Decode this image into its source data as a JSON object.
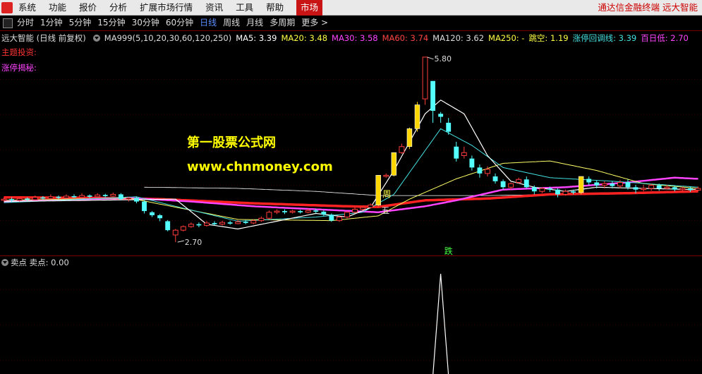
{
  "menubar": {
    "items": [
      "系统",
      "功能",
      "报价",
      "分析",
      "扩展市场行情",
      "资讯",
      "工具",
      "帮助"
    ],
    "market_tab": "市场",
    "brand": "通达信金融终端  远大智能"
  },
  "periodbar": {
    "items": [
      "分时",
      "1分钟",
      "5分钟",
      "15分钟",
      "30分钟",
      "60分钟",
      "日线",
      "周线",
      "月线",
      "多周期",
      "更多 >"
    ],
    "active": "日线"
  },
  "info": {
    "stock": "远大智能 (日线 前复权)",
    "indicator": "MA999(5,10,20,30,60,120,250)",
    "ma5": "MA5: 3.39",
    "ma20": "MA20: 3.48",
    "ma30": "MA30: 3.58",
    "ma60": "MA60: 3.74",
    "ma120": "MA120: 3.62",
    "ma250": "MA250: -",
    "gap": "跳空: 1.19",
    "limit": "涨停回调线: 3.39",
    "low100": "百日低: 2.70"
  },
  "labels": {
    "main_invest": "主题投资:",
    "limit_secret": "涨停揭秘:"
  },
  "watermark": {
    "line1": "第一股票公式网",
    "line2": "www.chnmoney.com"
  },
  "annotations": {
    "high": "5.80",
    "low": "2.70",
    "week": "周",
    "five": "五",
    "fall": "跌"
  },
  "subpanel": {
    "title": "卖点",
    "value_text": "卖点: 0.00"
  },
  "colors": {
    "up": "#ff3c3c",
    "down": "#54ffff",
    "ma5": "#ffffff",
    "ma10": "#ffff66",
    "ma20": "#44e0e0",
    "ma60": "#ff2222",
    "ma120": "#ff44ff",
    "ma250": "#ffffff",
    "limit_bar": "#ffd700"
  },
  "chart_data": {
    "type": "candlestick",
    "price_range": [
      2.5,
      6.0
    ],
    "highest": 5.8,
    "lowest": 2.7,
    "candles": [
      [
        3.4,
        3.42,
        3.45,
        3.38
      ],
      [
        3.42,
        3.4,
        3.45,
        3.37
      ],
      [
        3.4,
        3.43,
        3.46,
        3.38
      ],
      [
        3.43,
        3.41,
        3.45,
        3.39
      ],
      [
        3.41,
        3.45,
        3.48,
        3.4
      ],
      [
        3.45,
        3.43,
        3.47,
        3.41
      ],
      [
        3.43,
        3.46,
        3.5,
        3.42
      ],
      [
        3.46,
        3.44,
        3.48,
        3.42
      ],
      [
        3.44,
        3.47,
        3.5,
        3.43
      ],
      [
        3.47,
        3.45,
        3.5,
        3.44
      ],
      [
        3.45,
        3.48,
        3.52,
        3.44
      ],
      [
        3.48,
        3.46,
        3.5,
        3.44
      ],
      [
        3.46,
        3.49,
        3.52,
        3.45
      ],
      [
        3.49,
        3.47,
        3.51,
        3.45
      ],
      [
        3.47,
        3.5,
        3.53,
        3.46
      ],
      [
        3.5,
        3.42,
        3.52,
        3.4
      ],
      [
        3.42,
        3.44,
        3.46,
        3.38
      ],
      [
        3.44,
        3.38,
        3.46,
        3.35
      ],
      [
        3.38,
        3.22,
        3.4,
        3.18
      ],
      [
        3.2,
        3.15,
        3.22,
        3.12
      ],
      [
        3.15,
        3.1,
        3.17,
        3.05
      ],
      [
        3.05,
        2.9,
        3.07,
        2.88
      ],
      [
        2.82,
        2.9,
        2.92,
        2.7
      ],
      [
        2.9,
        2.96,
        2.98,
        2.88
      ],
      [
        2.96,
        3.0,
        3.03,
        2.94
      ],
      [
        3.0,
        2.98,
        3.03,
        2.95
      ],
      [
        2.98,
        3.02,
        3.05,
        2.96
      ],
      [
        3.02,
        3.0,
        3.05,
        2.98
      ],
      [
        3.0,
        3.03,
        3.06,
        2.98
      ],
      [
        3.03,
        3.01,
        3.06,
        2.99
      ],
      [
        3.01,
        3.04,
        3.07,
        3.0
      ],
      [
        3.04,
        3.02,
        3.07,
        3.0
      ],
      [
        3.02,
        3.06,
        3.08,
        3.0
      ],
      [
        3.06,
        3.1,
        3.13,
        3.04
      ],
      [
        3.1,
        3.2,
        3.23,
        3.08
      ],
      [
        3.2,
        3.22,
        3.25,
        3.17
      ],
      [
        3.22,
        3.2,
        3.25,
        3.17
      ],
      [
        3.2,
        3.22,
        3.24,
        3.18
      ],
      [
        3.22,
        3.2,
        3.24,
        3.18
      ],
      [
        3.2,
        3.23,
        3.26,
        3.18
      ],
      [
        3.23,
        3.21,
        3.26,
        3.18
      ],
      [
        3.21,
        3.16,
        3.23,
        3.14
      ],
      [
        3.16,
        3.06,
        3.18,
        3.04
      ],
      [
        3.06,
        3.12,
        3.14,
        3.04
      ],
      [
        3.12,
        3.2,
        3.22,
        3.1
      ],
      [
        3.2,
        3.25,
        3.28,
        3.18
      ],
      [
        3.25,
        3.28,
        3.3,
        3.23
      ],
      [
        3.28,
        3.32,
        3.35,
        3.26
      ],
      [
        3.32,
        3.82,
        3.82,
        3.3
      ],
      [
        3.8,
        3.82,
        3.85,
        3.78
      ],
      [
        3.82,
        4.2,
        4.2,
        3.8
      ],
      [
        4.2,
        4.3,
        4.35,
        4.18
      ],
      [
        4.3,
        4.6,
        4.62,
        4.26
      ],
      [
        4.6,
        5.0,
        5.05,
        4.55
      ],
      [
        5.1,
        5.8,
        5.8,
        5.0
      ],
      [
        5.4,
        4.9,
        5.4,
        4.7
      ],
      [
        4.85,
        4.8,
        4.88,
        4.7
      ],
      [
        4.7,
        4.55,
        4.78,
        4.5
      ],
      [
        4.3,
        4.1,
        4.38,
        4.05
      ],
      [
        4.15,
        4.2,
        4.3,
        4.1
      ],
      [
        4.1,
        3.95,
        4.15,
        3.9
      ],
      [
        3.95,
        3.85,
        4.0,
        3.78
      ],
      [
        3.85,
        3.92,
        3.97,
        3.8
      ],
      [
        3.8,
        3.72,
        3.85,
        3.68
      ],
      [
        3.72,
        3.62,
        3.75,
        3.58
      ],
      [
        3.62,
        3.68,
        3.7,
        3.58
      ],
      [
        3.7,
        3.75,
        3.78,
        3.68
      ],
      [
        3.75,
        3.62,
        3.8,
        3.6
      ],
      [
        3.62,
        3.55,
        3.65,
        3.5
      ],
      [
        3.55,
        3.6,
        3.62,
        3.52
      ],
      [
        3.6,
        3.58,
        3.63,
        3.54
      ],
      [
        3.58,
        3.5,
        3.6,
        3.45
      ],
      [
        3.5,
        3.55,
        3.58,
        3.48
      ],
      [
        3.55,
        3.53,
        3.58,
        3.5
      ],
      [
        3.53,
        3.8,
        3.8,
        3.5
      ],
      [
        3.76,
        3.7,
        3.8,
        3.66
      ],
      [
        3.7,
        3.65,
        3.74,
        3.6
      ],
      [
        3.65,
        3.68,
        3.72,
        3.6
      ],
      [
        3.68,
        3.64,
        3.72,
        3.6
      ],
      [
        3.64,
        3.7,
        3.74,
        3.6
      ],
      [
        3.7,
        3.62,
        3.75,
        3.58
      ],
      [
        3.62,
        3.58,
        3.66,
        3.52
      ],
      [
        3.58,
        3.6,
        3.66,
        3.55
      ],
      [
        3.6,
        3.65,
        3.68,
        3.56
      ],
      [
        3.65,
        3.6,
        3.68,
        3.56
      ],
      [
        3.6,
        3.62,
        3.66,
        3.58
      ],
      [
        3.62,
        3.58,
        3.65,
        3.55
      ],
      [
        3.58,
        3.6,
        3.63,
        3.55
      ],
      [
        3.6,
        3.57,
        3.63,
        3.54
      ],
      [
        3.57,
        3.6,
        3.63,
        3.55
      ]
    ],
    "limit_up_indices": [
      48,
      50,
      52,
      53,
      74
    ],
    "ma": {
      "ma5": [
        [
          0,
          3.38
        ],
        [
          22,
          3.42
        ],
        [
          26,
          3.0
        ],
        [
          30,
          2.92
        ],
        [
          40,
          3.18
        ],
        [
          44,
          3.12
        ],
        [
          47,
          3.28
        ],
        [
          50,
          3.9
        ],
        [
          54,
          4.85
        ],
        [
          56,
          5.08
        ],
        [
          59,
          4.85
        ],
        [
          62,
          4.15
        ],
        [
          65,
          3.72
        ],
        [
          68,
          3.62
        ],
        [
          72,
          3.55
        ],
        [
          76,
          3.62
        ],
        [
          82,
          3.6
        ],
        [
          89,
          3.58
        ]
      ],
      "ma10": [
        [
          0,
          3.4
        ],
        [
          16,
          3.44
        ],
        [
          30,
          3.08
        ],
        [
          42,
          3.06
        ],
        [
          48,
          3.14
        ],
        [
          52,
          3.42
        ],
        [
          58,
          3.76
        ],
        [
          64,
          4.02
        ],
        [
          70,
          4.06
        ],
        [
          76,
          3.9
        ],
        [
          82,
          3.68
        ],
        [
          89,
          3.6
        ]
      ],
      "ma20": [
        [
          0,
          3.36
        ],
        [
          17,
          3.46
        ],
        [
          22,
          3.3
        ],
        [
          30,
          3.05
        ],
        [
          40,
          3.12
        ],
        [
          46,
          3.2
        ],
        [
          50,
          3.5
        ],
        [
          56,
          4.6
        ],
        [
          60,
          4.32
        ],
        [
          64,
          3.95
        ],
        [
          70,
          3.78
        ],
        [
          78,
          3.72
        ],
        [
          89,
          3.62
        ]
      ],
      "ma60": [
        [
          0,
          3.45
        ],
        [
          12,
          3.44
        ],
        [
          20,
          3.42
        ],
        [
          32,
          3.35
        ],
        [
          44,
          3.3
        ],
        [
          48,
          3.29
        ],
        [
          54,
          3.4
        ],
        [
          62,
          3.43
        ],
        [
          70,
          3.5
        ],
        [
          80,
          3.52
        ],
        [
          89,
          3.55
        ]
      ],
      "ma120": [
        [
          0,
          3.38
        ],
        [
          16,
          3.44
        ],
        [
          24,
          3.38
        ],
        [
          32,
          3.3
        ],
        [
          40,
          3.25
        ],
        [
          48,
          3.2
        ],
        [
          54,
          3.3
        ],
        [
          58,
          3.4
        ],
        [
          64,
          3.58
        ],
        [
          72,
          3.62
        ],
        [
          80,
          3.7
        ],
        [
          86,
          3.78
        ],
        [
          89,
          3.76
        ]
      ],
      "ma250": [
        [
          18,
          3.62
        ],
        [
          30,
          3.6
        ],
        [
          40,
          3.55
        ],
        [
          48,
          3.48
        ],
        [
          54,
          3.48
        ],
        [
          62,
          3.48
        ],
        [
          72,
          3.5
        ],
        [
          80,
          3.52
        ],
        [
          89,
          3.55
        ]
      ]
    },
    "sell_signal": {
      "range": [
        0,
        1
      ],
      "values": [
        [
          0,
          0
        ],
        [
          55,
          0
        ],
        [
          56,
          1
        ],
        [
          57,
          0
        ],
        [
          89,
          0
        ]
      ]
    }
  }
}
